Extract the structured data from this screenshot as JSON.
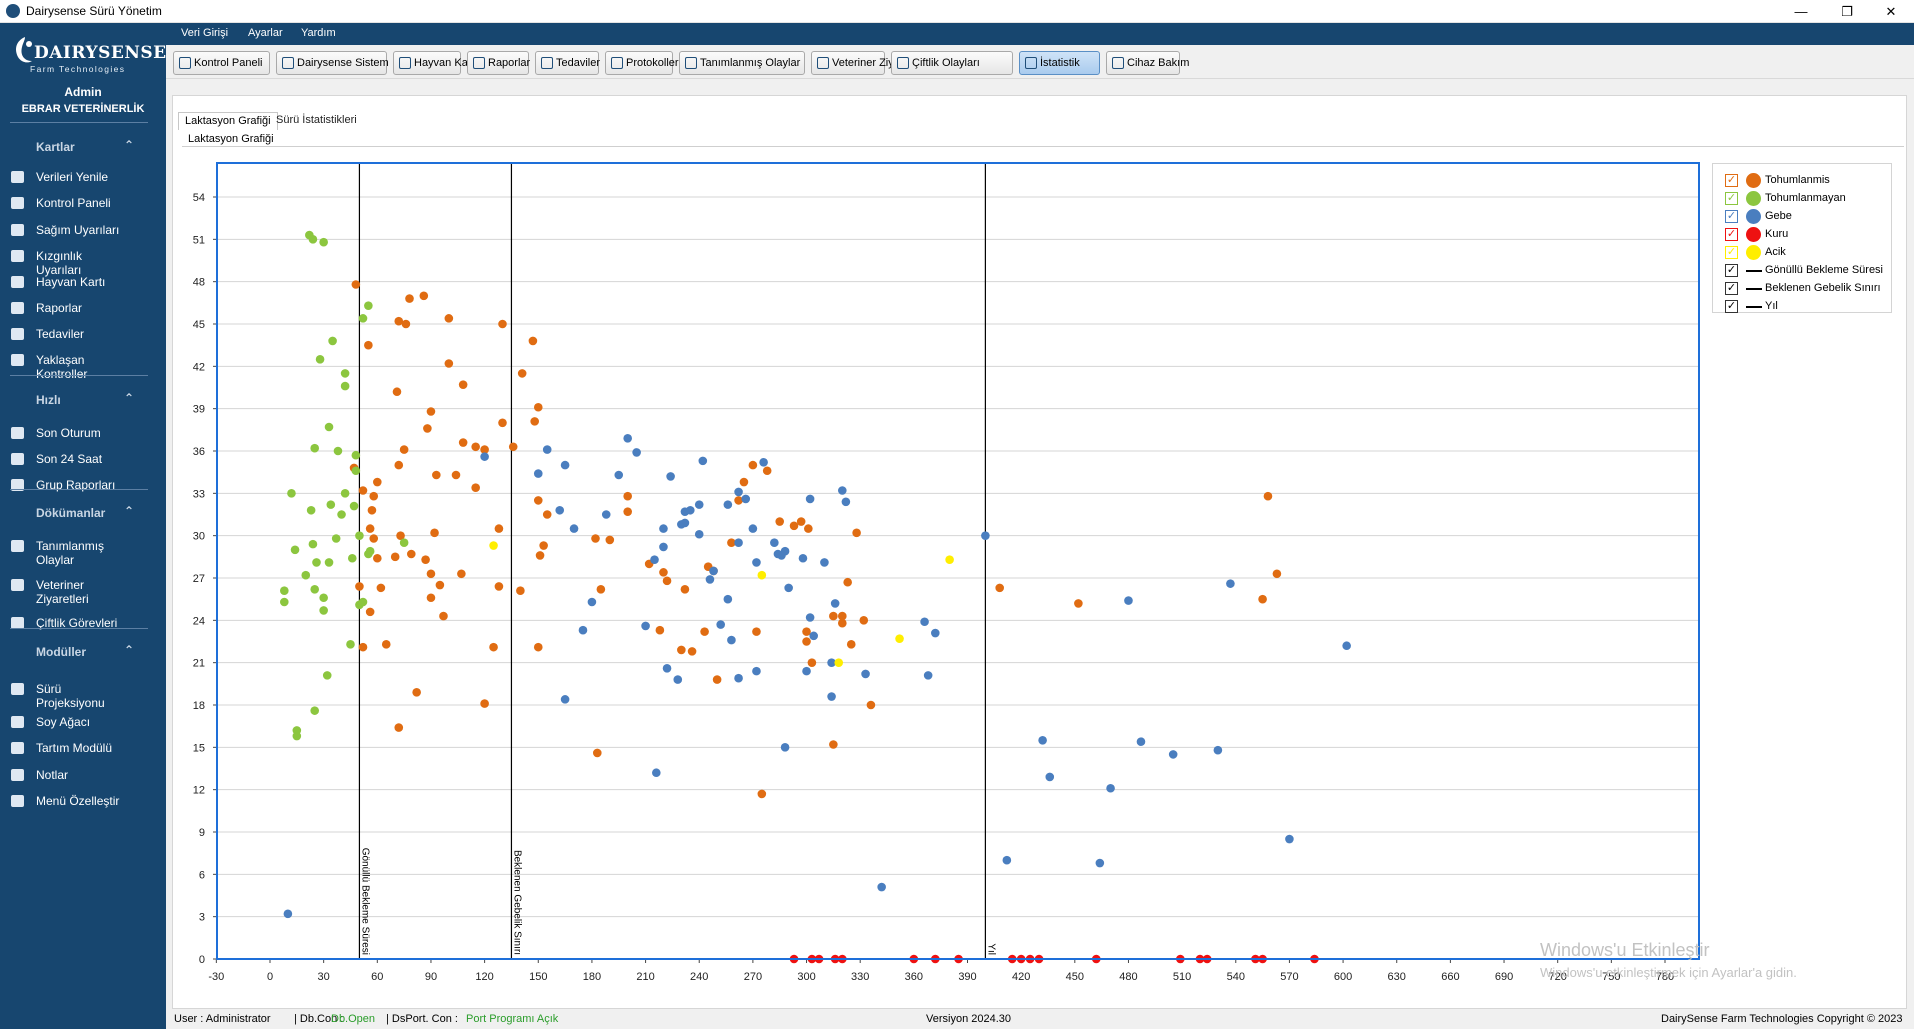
{
  "window": {
    "title": "Dairysense Sürü Yönetim"
  },
  "logo": {
    "brand": "DAIRYSENSE",
    "tagline": "Farm Technologies"
  },
  "user": {
    "name": "Admin",
    "org": "EBRAR VETERİNERLİK"
  },
  "sidebar": {
    "sections": [
      {
        "title": "Kartlar",
        "items": [
          "Verileri Yenile",
          "Kontrol Paneli",
          "Sağım Uyarıları",
          "Kızgınlık Uyarıları",
          "Hayvan Kartı",
          "Raporlar",
          "Tedaviler",
          "Yaklaşan Kontroller"
        ]
      },
      {
        "title": "Hızlı",
        "items": [
          "Son Oturum",
          "Son 24 Saat",
          "Grup Raporları"
        ]
      },
      {
        "title": "Dökümanlar",
        "items": [
          "Tanımlanmış Olaylar",
          "Veteriner Ziyaretleri",
          "Çiftlik Görevleri"
        ]
      },
      {
        "title": "Modüller",
        "items": [
          "Sürü Projeksiyonu",
          "Soy Ağacı",
          "Tartım Modülü",
          "Notlar",
          "Menü Özelleştir"
        ]
      }
    ]
  },
  "menu": [
    "Veri Girişi",
    "Ayarlar",
    "Yardım"
  ],
  "toolbar": [
    "Kontrol Paneli",
    "Dairysense Sistem",
    "Hayvan Kartı",
    "Raporlar",
    "Tedaviler",
    "Protokoller",
    "Tanımlanmış Olaylar",
    "Veteriner Ziyaretleri",
    "Çiftlik Olayları",
    "İstatistik",
    "Cihaz Bakım"
  ],
  "toolbar_active": "İstatistik",
  "tabs": [
    "Laktasyon Grafiği",
    "Sürü İstatistikleri"
  ],
  "group_title": "Laktasyon Grafiği",
  "legend": [
    {
      "label": "Tohumlanmis",
      "kind": "dot",
      "color": "#e06c12",
      "checked": true
    },
    {
      "label": "Tohumlanmayan",
      "kind": "dot",
      "color": "#8cc63f",
      "checked": true
    },
    {
      "label": "Gebe",
      "kind": "dot",
      "color": "#4a7ebf",
      "checked": true
    },
    {
      "label": "Kuru",
      "kind": "dot",
      "color": "#ee1111",
      "checked": true
    },
    {
      "label": "Acik",
      "kind": "dot",
      "color": "#ffee00",
      "checked": true
    },
    {
      "label": "Gönüllü Bekleme Süresi",
      "kind": "line",
      "color": "#000000",
      "checked": true
    },
    {
      "label": "Beklenen Gebelik Sınırı",
      "kind": "line",
      "color": "#000000",
      "checked": true
    },
    {
      "label": "Yıl",
      "kind": "line",
      "color": "#000000",
      "checked": true
    }
  ],
  "watermark": {
    "line1": "Windows'u Etkinleştir",
    "line2": "Windows'u etkinleştirmek için Ayarlar'a gidin."
  },
  "status": {
    "user": "User : Administrator",
    "db_label": "| Db.Con :",
    "db_value": "Db.Open",
    "port_label": "| DsPort. Con :",
    "port_value": "Port Programı Açık",
    "version": "Versiyon 2024.30",
    "copyright": "DairySense Farm Technologies Copyright © 2023"
  },
  "chart_data": {
    "type": "scatter",
    "xlabel": "",
    "ylabel": "",
    "xlim": [
      -45,
      795
    ],
    "ylim": [
      0,
      56
    ],
    "xticks": [
      -30,
      0,
      30,
      60,
      90,
      120,
      150,
      180,
      210,
      240,
      270,
      300,
      330,
      360,
      390,
      420,
      450,
      480,
      510,
      540,
      570,
      600,
      630,
      660,
      690,
      720,
      750,
      780
    ],
    "yticks": [
      0,
      3,
      6,
      9,
      12,
      15,
      18,
      21,
      24,
      27,
      30,
      33,
      36,
      39,
      42,
      45,
      48,
      51,
      54
    ],
    "grid": true,
    "vlines": [
      {
        "x": 50,
        "label": "Gönüllü Bekleme Süresi"
      },
      {
        "x": 135,
        "label": "Beklenen Gebelik Sınırı"
      },
      {
        "x": 400,
        "label": "Yıl"
      }
    ],
    "series": [
      {
        "name": "Tohumlanmis",
        "color": "#e06c12",
        "points": [
          [
            48,
            47.8
          ],
          [
            55,
            43.5
          ],
          [
            72,
            45.2
          ],
          [
            76,
            45
          ],
          [
            78,
            46.8
          ],
          [
            86,
            47
          ],
          [
            100,
            45.4
          ],
          [
            130,
            45
          ],
          [
            147,
            43.8
          ],
          [
            141,
            41.5
          ],
          [
            100,
            42.2
          ],
          [
            108,
            40.7
          ],
          [
            71,
            40.2
          ],
          [
            90,
            38.8
          ],
          [
            88,
            37.6
          ],
          [
            75,
            36.1
          ],
          [
            104,
            34.3
          ],
          [
            108,
            36.6
          ],
          [
            115,
            36.3
          ],
          [
            120,
            36.1
          ],
          [
            130,
            38
          ],
          [
            136,
            36.3
          ],
          [
            150,
            39.1
          ],
          [
            148,
            38.1
          ],
          [
            47,
            34.8
          ],
          [
            52,
            33.2
          ],
          [
            58,
            32.8
          ],
          [
            60,
            33.8
          ],
          [
            72,
            35
          ],
          [
            93,
            34.3
          ],
          [
            115,
            33.4
          ],
          [
            150,
            32.5
          ],
          [
            155,
            31.5
          ],
          [
            153,
            29.3
          ],
          [
            151,
            28.6
          ],
          [
            128,
            30.5
          ],
          [
            92,
            30.2
          ],
          [
            73,
            30
          ],
          [
            79,
            28.7
          ],
          [
            60,
            28.4
          ],
          [
            58,
            29.8
          ],
          [
            57,
            31.8
          ],
          [
            56,
            30.5
          ],
          [
            70,
            28.5
          ],
          [
            87,
            28.3
          ],
          [
            90,
            27.3
          ],
          [
            95,
            26.5
          ],
          [
            107,
            27.3
          ],
          [
            62,
            26.3
          ],
          [
            50,
            26.4
          ],
          [
            90,
            25.6
          ],
          [
            97,
            24.3
          ],
          [
            56,
            24.6
          ],
          [
            65,
            22.3
          ],
          [
            52,
            22.1
          ],
          [
            140,
            26.1
          ],
          [
            128,
            26.4
          ],
          [
            125,
            22.1
          ],
          [
            150,
            22.1
          ],
          [
            72,
            16.4
          ],
          [
            82,
            18.9
          ],
          [
            120,
            18.1
          ],
          [
            182,
            29.8
          ],
          [
            190,
            29.7
          ],
          [
            185,
            26.2
          ],
          [
            200,
            31.7
          ],
          [
            200,
            32.8
          ],
          [
            212,
            28
          ],
          [
            220,
            27.4
          ],
          [
            222,
            26.8
          ],
          [
            232,
            26.2
          ],
          [
            245,
            27.8
          ],
          [
            248,
            27.5
          ],
          [
            258,
            29.5
          ],
          [
            265,
            33.8
          ],
          [
            270,
            35
          ],
          [
            278,
            34.6
          ],
          [
            285,
            31
          ],
          [
            293,
            30.7
          ],
          [
            262,
            32.5
          ],
          [
            300,
            22.5
          ],
          [
            303,
            21
          ],
          [
            315,
            15.2
          ],
          [
            320,
            23.8
          ],
          [
            325,
            22.3
          ],
          [
            328,
            30.2
          ],
          [
            332,
            24
          ],
          [
            336,
            18
          ],
          [
            218,
            23.3
          ],
          [
            230,
            21.9
          ],
          [
            236,
            21.8
          ],
          [
            243,
            23.2
          ],
          [
            250,
            19.8
          ],
          [
            272,
            23.2
          ],
          [
            275,
            11.7
          ],
          [
            183,
            14.6
          ],
          [
            320,
            24.3
          ],
          [
            323,
            26.7
          ],
          [
            301,
            30.5
          ],
          [
            297,
            31
          ],
          [
            315,
            24.3
          ],
          [
            300,
            23.2
          ],
          [
            408,
            26.3
          ],
          [
            452,
            25.2
          ],
          [
            555,
            25.5
          ],
          [
            558,
            32.8
          ],
          [
            563,
            27.3
          ]
        ]
      },
      {
        "name": "Tohumlanmayan",
        "color": "#8cc63f",
        "points": [
          [
            22,
            51.3
          ],
          [
            24,
            51
          ],
          [
            30,
            50.8
          ],
          [
            55,
            46.3
          ],
          [
            52,
            45.4
          ],
          [
            35,
            43.8
          ],
          [
            28,
            42.5
          ],
          [
            42,
            41.5
          ],
          [
            42,
            40.6
          ],
          [
            33,
            37.7
          ],
          [
            25,
            36.2
          ],
          [
            38,
            36
          ],
          [
            48,
            35.7
          ],
          [
            48,
            34.6
          ],
          [
            12,
            33
          ],
          [
            42,
            33
          ],
          [
            47,
            32.1
          ],
          [
            34,
            32.2
          ],
          [
            23,
            31.8
          ],
          [
            40,
            31.5
          ],
          [
            50,
            30
          ],
          [
            37,
            29.8
          ],
          [
            14,
            29
          ],
          [
            24,
            29.4
          ],
          [
            26,
            28.1
          ],
          [
            33,
            28.1
          ],
          [
            46,
            28.4
          ],
          [
            55,
            28.7
          ],
          [
            56,
            28.9
          ],
          [
            20,
            27.2
          ],
          [
            8,
            26.1
          ],
          [
            25,
            26.2
          ],
          [
            30,
            25.6
          ],
          [
            8,
            25.3
          ],
          [
            50,
            25.1
          ],
          [
            52,
            25.3
          ],
          [
            30,
            24.7
          ],
          [
            45,
            22.3
          ],
          [
            32,
            20.1
          ],
          [
            25,
            17.6
          ],
          [
            15,
            16.2
          ],
          [
            15,
            15.8
          ],
          [
            75,
            29.5
          ]
        ]
      },
      {
        "name": "Gebe",
        "color": "#4a7ebf",
        "points": [
          [
            10,
            3.2
          ],
          [
            120,
            35.6
          ],
          [
            155,
            36.1
          ],
          [
            150,
            34.4
          ],
          [
            165,
            35
          ],
          [
            162,
            31.8
          ],
          [
            170,
            30.5
          ],
          [
            175,
            23.3
          ],
          [
            165,
            18.4
          ],
          [
            180,
            25.3
          ],
          [
            188,
            31.5
          ],
          [
            195,
            34.3
          ],
          [
            200,
            36.9
          ],
          [
            205,
            35.9
          ],
          [
            210,
            23.6
          ],
          [
            215,
            28.3
          ],
          [
            220,
            29.2
          ],
          [
            224,
            34.2
          ],
          [
            220,
            30.5
          ],
          [
            230,
            30.8
          ],
          [
            232,
            31.7
          ],
          [
            235,
            31.8
          ],
          [
            240,
            32.2
          ],
          [
            240,
            30.1
          ],
          [
            242,
            35.3
          ],
          [
            246,
            26.9
          ],
          [
            248,
            27.5
          ],
          [
            252,
            23.7
          ],
          [
            256,
            25.5
          ],
          [
            258,
            22.6
          ],
          [
            262,
            29.5
          ],
          [
            266,
            32.6
          ],
          [
            270,
            30.5
          ],
          [
            272,
            28.1
          ],
          [
            276,
            35.2
          ],
          [
            282,
            29.5
          ],
          [
            286,
            28.6
          ],
          [
            290,
            26.3
          ],
          [
            298,
            28.4
          ],
          [
            302,
            32.6
          ],
          [
            304,
            22.9
          ],
          [
            310,
            28.1
          ],
          [
            314,
            18.6
          ],
          [
            316,
            25.2
          ],
          [
            320,
            33.2
          ],
          [
            322,
            32.4
          ],
          [
            300,
            20.4
          ],
          [
            256,
            32.2
          ],
          [
            262,
            33.1
          ],
          [
            222,
            20.6
          ],
          [
            228,
            19.8
          ],
          [
            232,
            30.9
          ],
          [
            262,
            19.9
          ],
          [
            272,
            20.4
          ],
          [
            284,
            28.7
          ],
          [
            288,
            28.9
          ],
          [
            302,
            24.2
          ],
          [
            314,
            21
          ],
          [
            333,
            20.2
          ],
          [
            366,
            23.9
          ],
          [
            368,
            20.1
          ],
          [
            372,
            23.1
          ],
          [
            288,
            15
          ],
          [
            342,
            5.1
          ],
          [
            216,
            13.2
          ],
          [
            400,
            30
          ],
          [
            412,
            7
          ],
          [
            432,
            15.5
          ],
          [
            436,
            12.9
          ],
          [
            464,
            6.8
          ],
          [
            470,
            12.1
          ],
          [
            480,
            25.4
          ],
          [
            487,
            15.4
          ],
          [
            505,
            14.5
          ],
          [
            530,
            14.8
          ],
          [
            537,
            26.6
          ],
          [
            570,
            8.5
          ],
          [
            602,
            22.2
          ]
        ]
      },
      {
        "name": "Kuru",
        "color": "#ee1111",
        "points": [
          [
            293,
            0
          ],
          [
            303,
            0
          ],
          [
            307,
            0
          ],
          [
            316,
            0
          ],
          [
            320,
            0
          ],
          [
            360,
            0
          ],
          [
            372,
            0
          ],
          [
            385,
            0
          ],
          [
            415,
            0
          ],
          [
            420,
            0
          ],
          [
            425,
            0
          ],
          [
            430,
            0
          ],
          [
            462,
            0
          ],
          [
            509,
            0
          ],
          [
            520,
            0
          ],
          [
            524,
            0
          ],
          [
            551,
            0
          ],
          [
            555,
            0
          ],
          [
            584,
            0
          ]
        ]
      },
      {
        "name": "Acik",
        "color": "#ffee00",
        "points": [
          [
            125,
            29.3
          ],
          [
            275,
            27.2
          ],
          [
            318,
            21
          ],
          [
            352,
            22.7
          ],
          [
            380,
            28.3
          ]
        ]
      }
    ]
  }
}
